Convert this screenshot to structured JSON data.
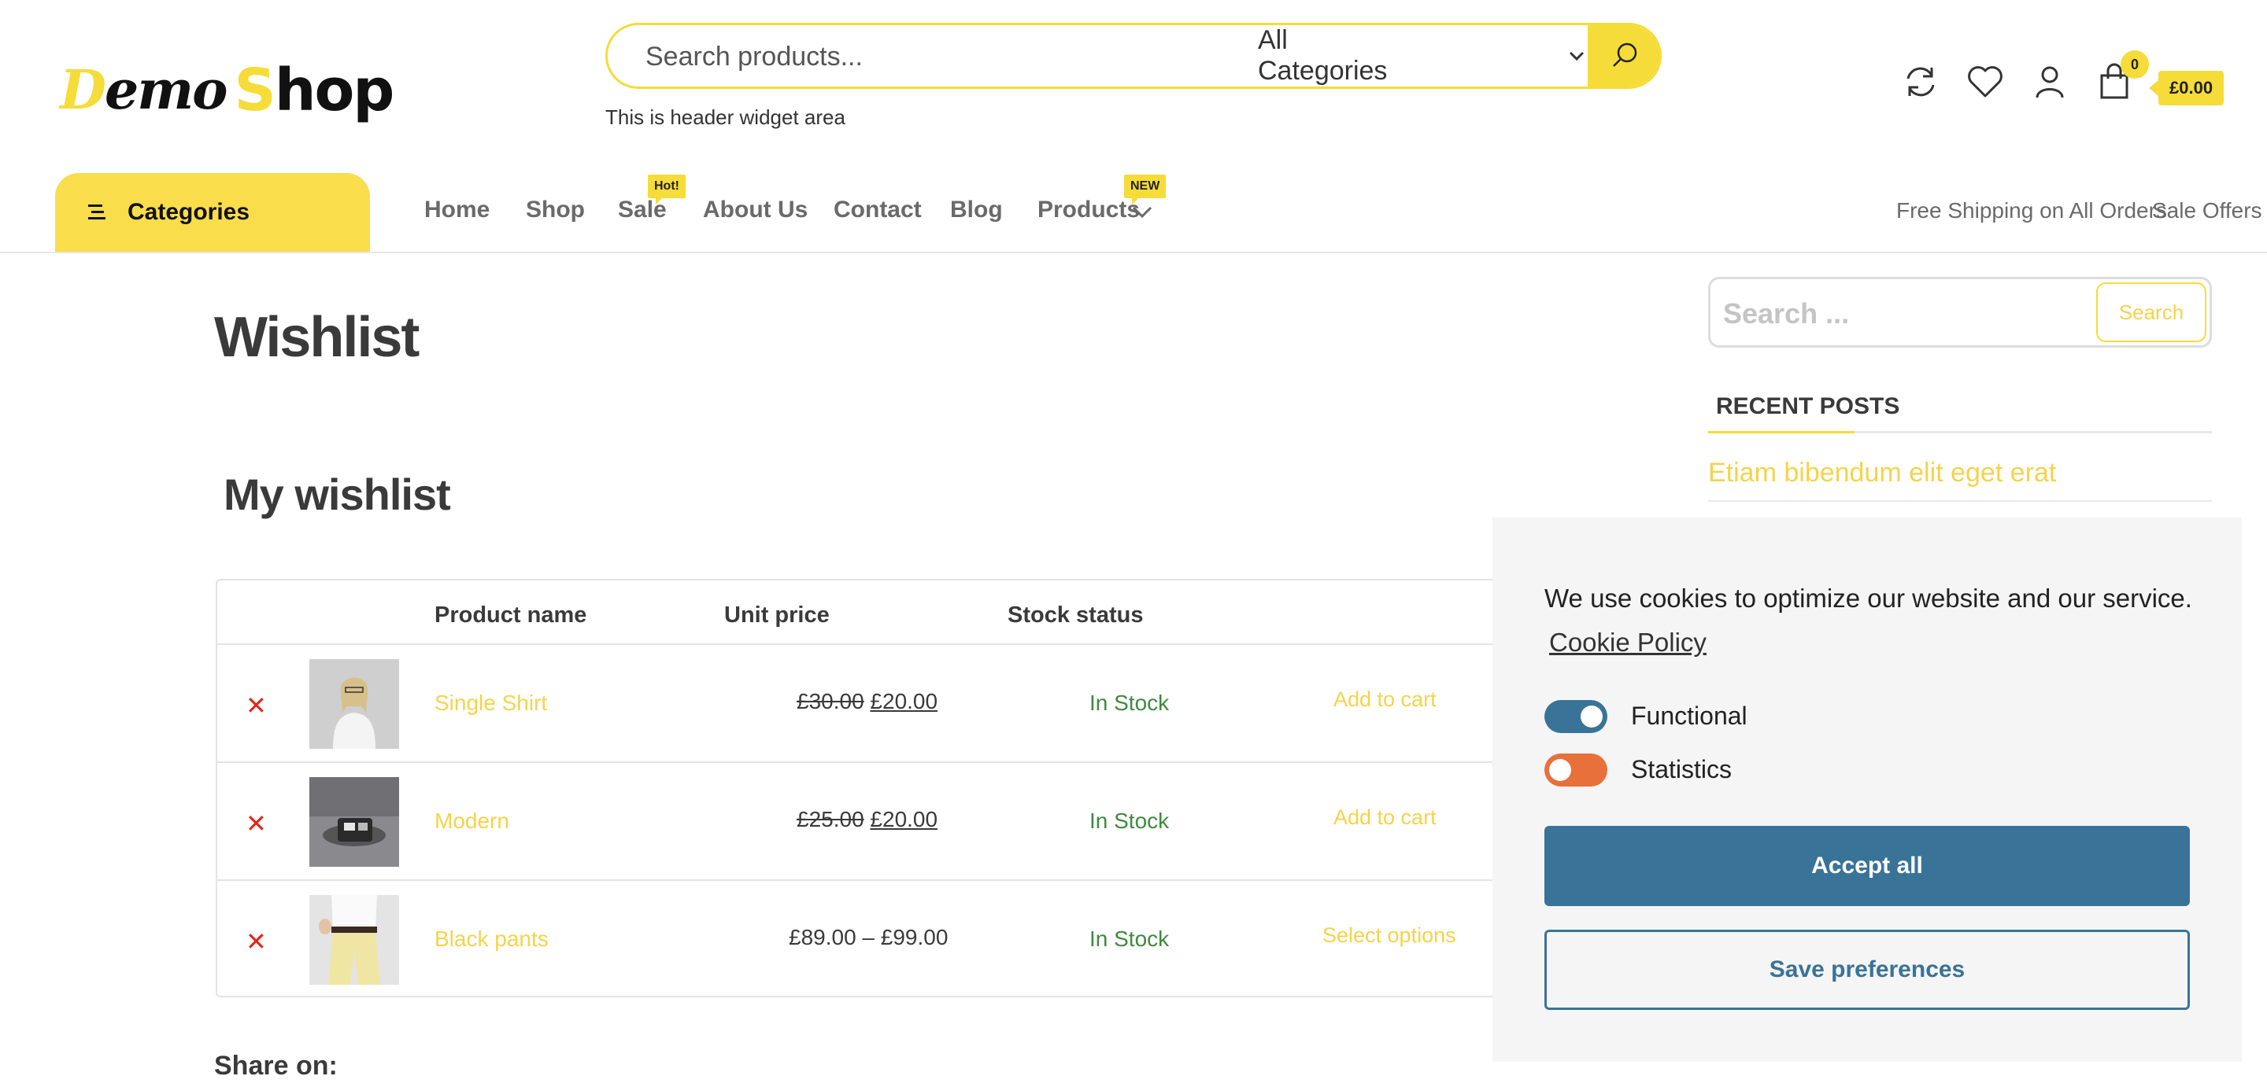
{
  "header": {
    "logo": {
      "word1_a": "D",
      "word1_b": "emo",
      "word2_a": "S",
      "word2_b": "hop"
    },
    "search": {
      "placeholder": "Search products...",
      "category": "All Categories"
    },
    "widget_text": "This is header widget area",
    "icons": [
      "refresh-icon",
      "heart-icon",
      "user-icon",
      "bag-icon"
    ],
    "cart": {
      "count": "0",
      "total": "£0.00"
    }
  },
  "nav": {
    "categories_label": "Categories",
    "items": [
      {
        "label": "Home"
      },
      {
        "label": "Shop"
      },
      {
        "label": "Sale",
        "badge": "Hot!"
      },
      {
        "label": "About Us"
      },
      {
        "label": "Contact"
      },
      {
        "label": "Blog"
      },
      {
        "label": "Products",
        "badge": "NEW"
      }
    ],
    "right_links": [
      "Free Shipping on All Orders",
      "Sale Offers"
    ]
  },
  "main": {
    "page_title": "Wishlist",
    "wishlist_title": "My wishlist",
    "table": {
      "headers": [
        "Product name",
        "Unit price",
        "Stock status"
      ],
      "rows": [
        {
          "name": "Single Shirt",
          "old_price": "£30.00",
          "price": "£20.00",
          "stock": "In Stock",
          "action": "Add to cart"
        },
        {
          "name": "Modern",
          "old_price": "£25.00",
          "price": "£20.00",
          "stock": "In Stock",
          "action": "Add to cart"
        },
        {
          "name": "Black pants",
          "old_price": "",
          "price": "£89.00 – £99.00",
          "stock": "In Stock",
          "action": "Select options"
        }
      ]
    },
    "share_label": "Share on:"
  },
  "sidebar": {
    "search_placeholder": "Search ...",
    "search_button": "Search",
    "recent_posts_title": "RECENT POSTS",
    "posts": [
      "Etiam bibendum elit eget erat"
    ]
  },
  "cookie": {
    "text": "We use cookies to optimize our website and our service.",
    "policy_link": "Cookie Policy",
    "toggles": [
      {
        "label": "Functional",
        "on": true,
        "color": "#3a7398"
      },
      {
        "label": "Statistics",
        "on": false,
        "color": "#e8703a"
      }
    ],
    "accept": "Accept all",
    "save": "Save preferences"
  },
  "colors": {
    "accent": "#f5dc38",
    "cookie_primary": "#3a7398",
    "remove": "#e1261c",
    "in_stock": "#3f8a3f"
  }
}
